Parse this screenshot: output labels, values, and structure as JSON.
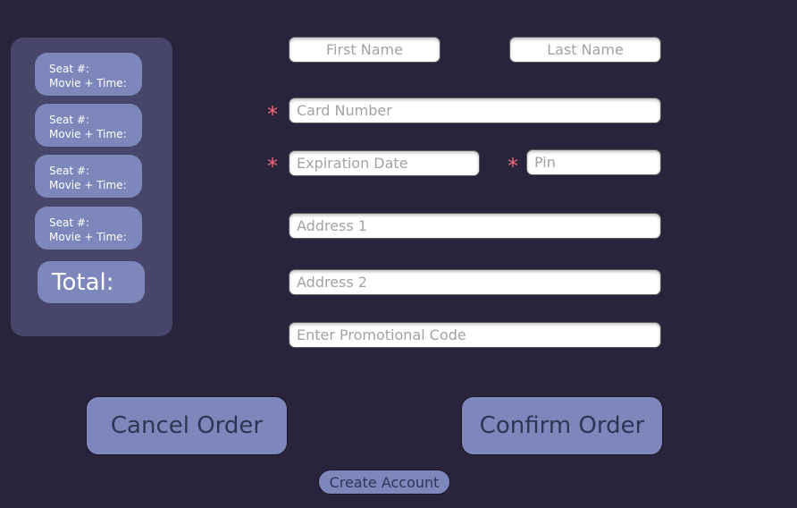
{
  "cart": {
    "seats": [
      {
        "seat_label": "Seat #:",
        "movie_label": "Movie + Time:"
      },
      {
        "seat_label": "Seat #:",
        "movie_label": "Movie + Time:"
      },
      {
        "seat_label": "Seat #:",
        "movie_label": "Movie + Time:"
      },
      {
        "seat_label": "Seat #:",
        "movie_label": "Movie + Time:"
      }
    ],
    "total_label": "Total:"
  },
  "form": {
    "first_name": {
      "placeholder": "First Name",
      "value": ""
    },
    "last_name": {
      "placeholder": "Last Name",
      "value": ""
    },
    "card_number": {
      "placeholder": "Card Number",
      "value": "",
      "required_mark": "*"
    },
    "expiration_date": {
      "placeholder": "Expiration Date",
      "value": "",
      "required_mark": "*"
    },
    "pin": {
      "placeholder": "Pin",
      "value": "",
      "required_mark": "*"
    },
    "address1": {
      "placeholder": "Address 1",
      "value": ""
    },
    "address2": {
      "placeholder": "Address 2",
      "value": ""
    },
    "promo_code": {
      "placeholder": "Enter Promotional Code",
      "value": ""
    }
  },
  "actions": {
    "cancel_label": "Cancel Order",
    "confirm_label": "Confirm Order",
    "create_account_label": "Create Account"
  },
  "colors": {
    "background": "#29233c",
    "panel": "#47456a",
    "button": "#7d87bb",
    "required": "#f06a78"
  }
}
